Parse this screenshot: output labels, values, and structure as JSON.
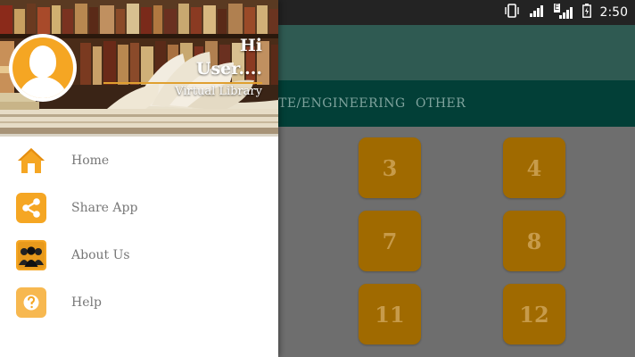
{
  "status_bar": {
    "time": "2:50",
    "network_badge": "E"
  },
  "tabs": [
    {
      "label": "TE/ENGINEERING"
    },
    {
      "label": "OTHER"
    }
  ],
  "tiles": [
    {
      "label": "3"
    },
    {
      "label": "4"
    },
    {
      "label": "7"
    },
    {
      "label": "8"
    },
    {
      "label": "11"
    },
    {
      "label": "12"
    }
  ],
  "drawer": {
    "greeting": "Hi",
    "user": "User....",
    "subtitle": "Virtual Library",
    "menu": [
      {
        "label": "Home",
        "icon": "home-icon"
      },
      {
        "label": "Share App",
        "icon": "share-icon"
      },
      {
        "label": "About Us",
        "icon": "people-icon"
      },
      {
        "label": "Help",
        "icon": "help-icon"
      }
    ]
  },
  "colors": {
    "accent": "#f5a623",
    "tab_bar": "#023f37",
    "toolbar": "#2f5a52",
    "status_bar": "#232323"
  }
}
